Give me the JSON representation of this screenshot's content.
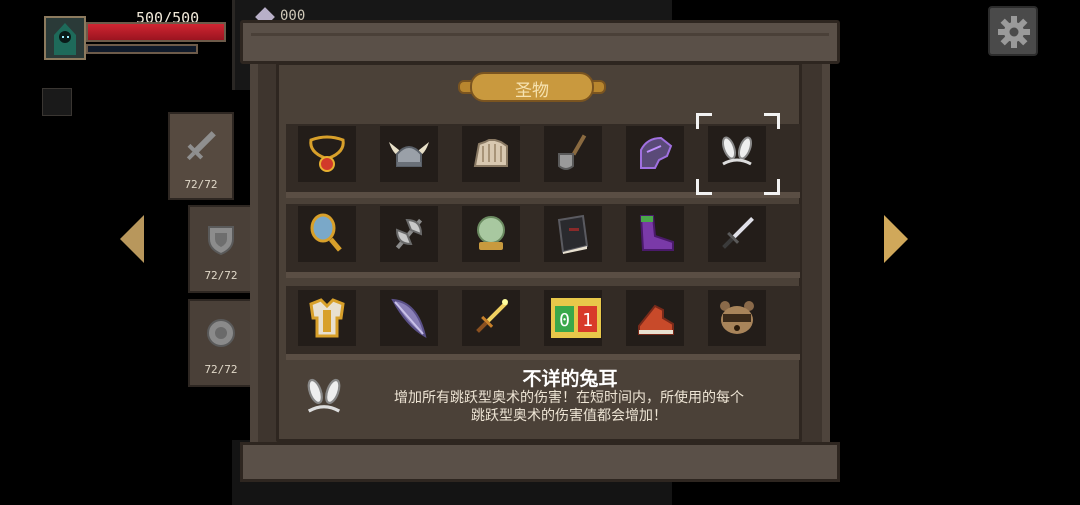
{
  "hud": {
    "hp_text": "500/500",
    "hp_fraction": 1.0,
    "mp_fraction": 0.0,
    "gem_count": "000"
  },
  "categories": [
    {
      "icon": "sword-icon",
      "count": "72/72",
      "active": true
    },
    {
      "icon": "shield-icon",
      "count": "72/72",
      "active": false
    },
    {
      "icon": "medallion-icon",
      "count": "72/72",
      "active": false
    }
  ],
  "panel": {
    "title": "圣物"
  },
  "relics": [
    [
      "amulet-icon",
      "viking-helmet-icon",
      "claw-glove-icon",
      "shovel-icon",
      "purple-gauntlet-icon",
      "bunny-ears-icon"
    ],
    [
      "hand-mirror-icon",
      "battle-axe-icon",
      "crystal-orb-icon",
      "spellbook-icon",
      "purple-boot-icon",
      "dagger-icon"
    ],
    [
      "golden-armor-icon",
      "feather-icon",
      "golden-dagger-icon",
      "calendar-icon",
      "red-boot-icon",
      "raccoon-mask-icon"
    ]
  ],
  "calendar_digits": [
    "0",
    "1"
  ],
  "selected": {
    "name": "不详的兔耳",
    "line1": "增加所有跳跃型奥术的伤害！在短时间内，所使用的每个",
    "line2": "跳跃型奥术的伤害值都会增加！"
  },
  "colors": {
    "accent_gold": "#c9993e",
    "hp_red": "#d02632",
    "wood": "#4b4138"
  }
}
